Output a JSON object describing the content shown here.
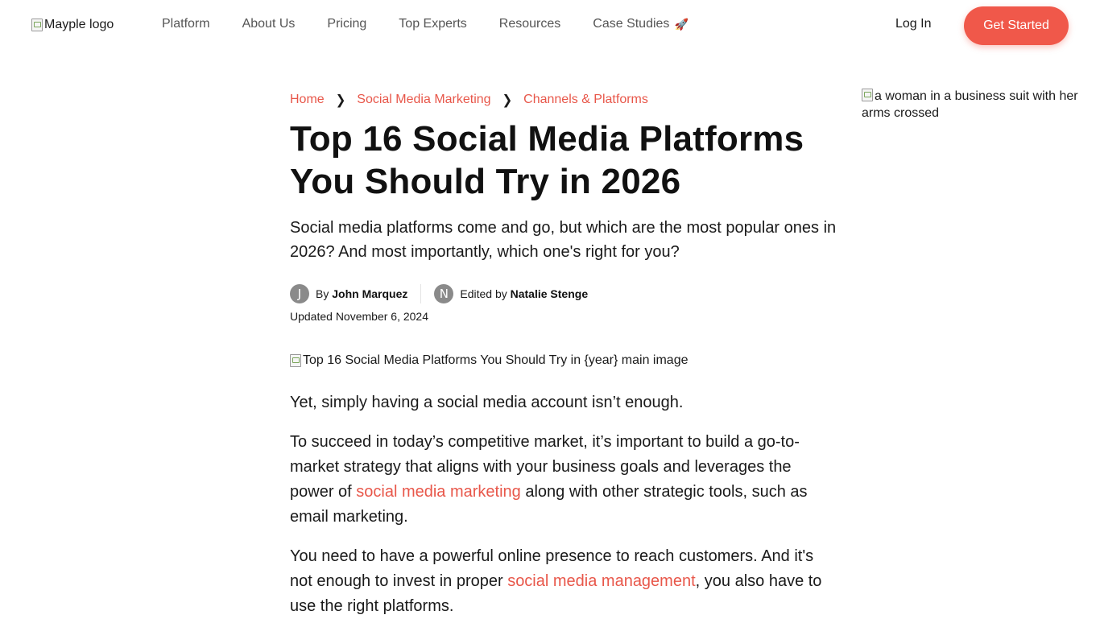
{
  "header": {
    "logo_alt": "Mayple logo",
    "nav": [
      {
        "label": "Platform"
      },
      {
        "label": "About Us"
      },
      {
        "label": "Pricing"
      },
      {
        "label": "Top Experts"
      },
      {
        "label": "Resources"
      },
      {
        "label": "Case Studies"
      }
    ],
    "case_studies_icon": "rocket-icon",
    "login_label": "Log In",
    "cta_label": "Get Started",
    "accent_color": "#f0584a"
  },
  "breadcrumb": [
    {
      "label": "Home"
    },
    {
      "label": "Social Media Marketing"
    },
    {
      "label": "Channels & Platforms"
    }
  ],
  "article": {
    "title": "Top 16 Social Media Platforms You Should Try in 2026",
    "subtitle": "Social media platforms come and go, but which are the most popular ones in 2026? And most importantly, which one's right for you?",
    "author": {
      "initial": "J",
      "prefix": "By",
      "name": "John Marquez"
    },
    "editor": {
      "initial": "N",
      "prefix": "Edited by",
      "name": "Natalie Stenge"
    },
    "updated": "Updated November 6, 2024",
    "main_image_alt": "Top 16 Social Media Platforms You Should Try in {year} main image",
    "paragraph1": "Yet, simply having a social media account isn’t enough.",
    "paragraph2": {
      "before": "To succeed in today’s competitive market, it’s important to build a go-to-market strategy that aligns with your business goals and leverages the power of ",
      "link": "social media marketing",
      "after": " along with other strategic tools, such as email marketing."
    },
    "paragraph3": {
      "before": "You need to have a powerful online presence to reach customers. And it's not enough to invest in proper ",
      "link": "social media management",
      "after": ", you also have to use the right platforms."
    }
  },
  "sidebar": {
    "image_alt": "a woman in a business suit with her arms crossed"
  }
}
